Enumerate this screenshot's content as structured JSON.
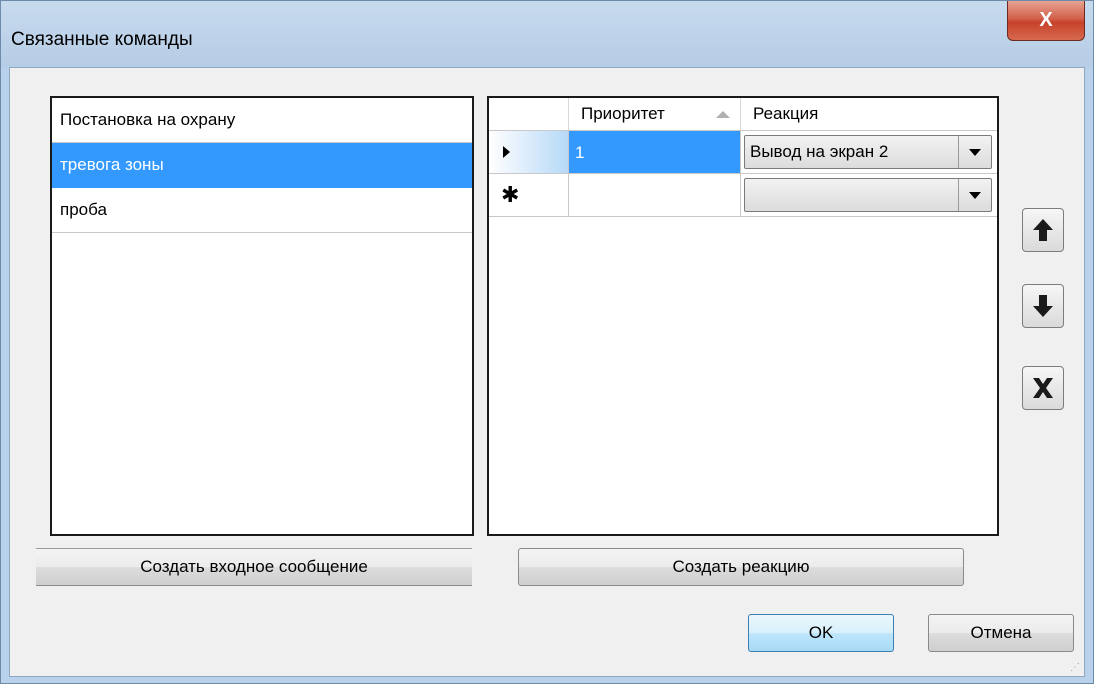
{
  "window": {
    "title": "Связанные команды",
    "close_glyph": "X"
  },
  "messages_list": {
    "items": [
      {
        "label": "Постановка на охрану",
        "selected": false
      },
      {
        "label": "тревога зоны",
        "selected": true
      },
      {
        "label": "проба",
        "selected": false
      }
    ]
  },
  "reactions_grid": {
    "columns": [
      {
        "label": "Приоритет",
        "sorted": "ascending"
      },
      {
        "label": "Реакция"
      }
    ],
    "rows": [
      {
        "marker": "current-row-icon",
        "priority": "1",
        "reaction": "Вывод на экран 2"
      },
      {
        "marker": "new-row-icon",
        "priority": "",
        "reaction": ""
      }
    ]
  },
  "side_buttons": [
    {
      "name": "move-up-button",
      "icon": "arrow-up-icon"
    },
    {
      "name": "move-down-button",
      "icon": "arrow-down-icon"
    },
    {
      "name": "delete-button",
      "icon": "x-icon"
    }
  ],
  "buttons": {
    "create_message": "Создать входное сообщение",
    "create_reaction": "Создать реакцию",
    "ok": "OK",
    "cancel": "Отмена"
  },
  "colors": {
    "selection": "#3399ff",
    "title_bar": "#b9d1ea",
    "close_button": "#c7412a"
  }
}
